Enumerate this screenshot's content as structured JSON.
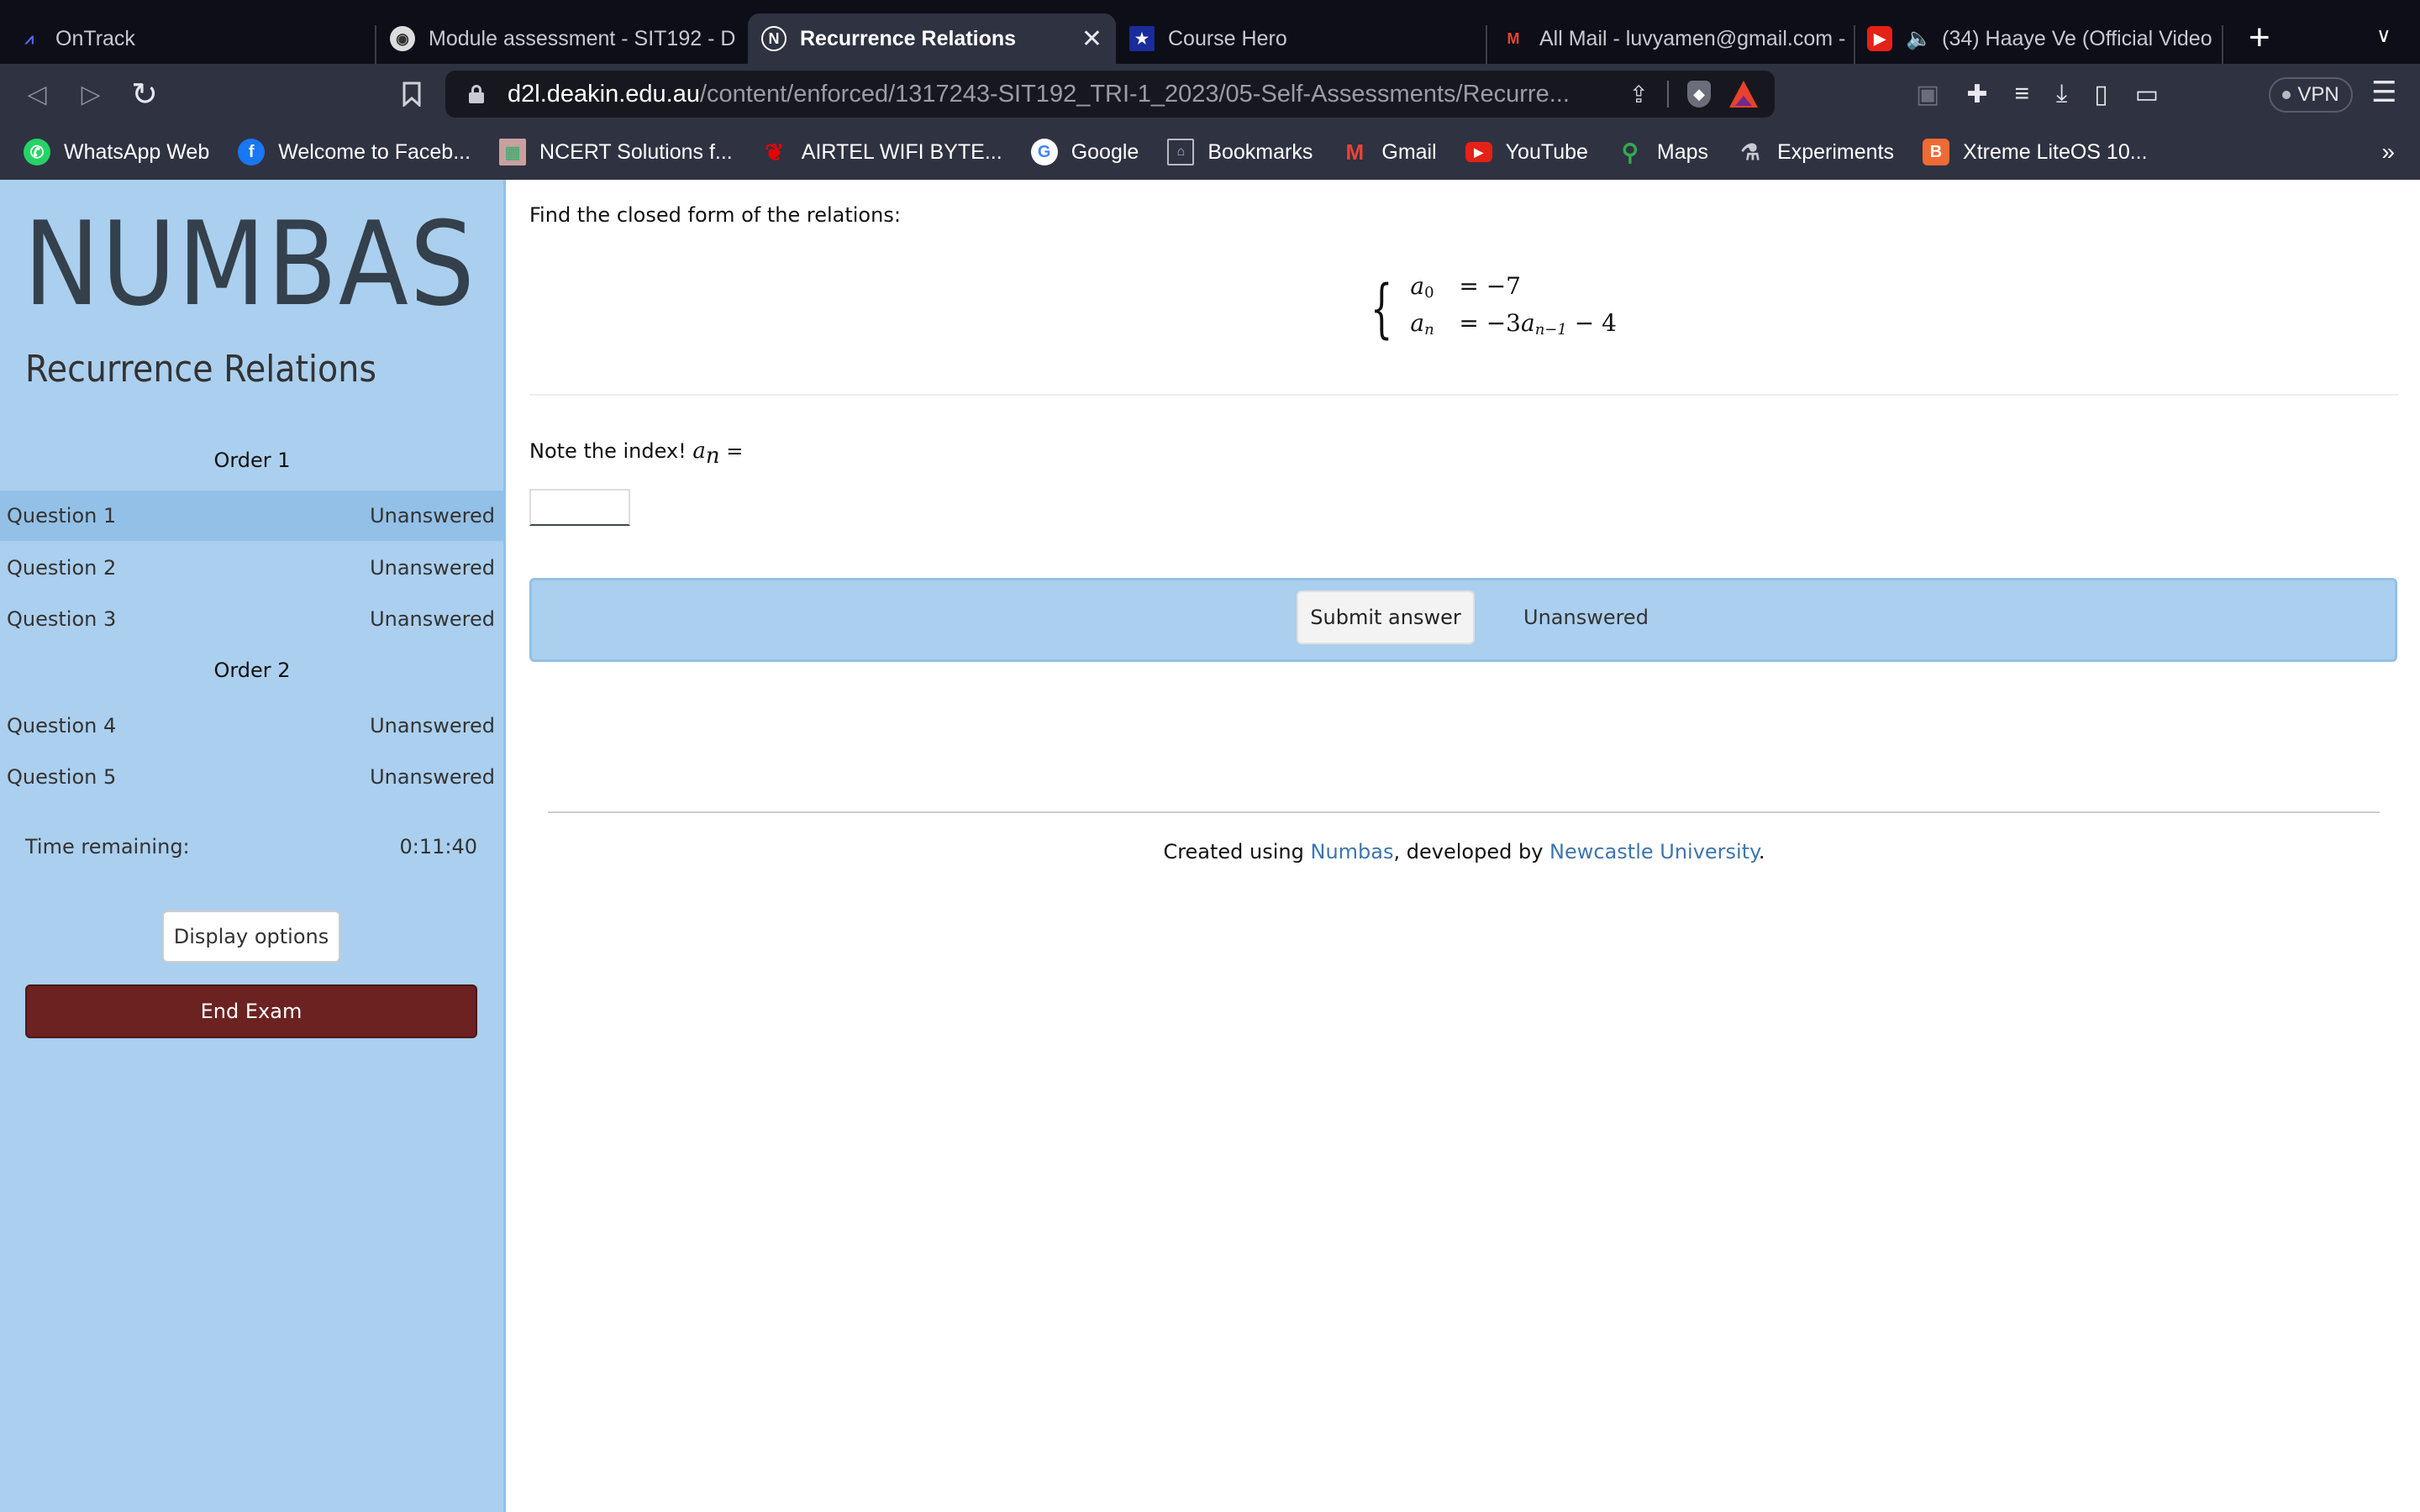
{
  "browser": {
    "tabs": [
      {
        "title": "OnTrack",
        "icon": "ontrack-logo-icon",
        "active": false
      },
      {
        "title": "Module assessment - SIT192 - D",
        "icon": "deakin-crest-icon",
        "active": false
      },
      {
        "title": "Recurrence Relations",
        "icon": "numbas-n-icon",
        "active": true
      },
      {
        "title": "Course Hero",
        "icon": "course-hero-star-icon",
        "active": false
      },
      {
        "title": "All Mail - luvyamen@gmail.com -",
        "icon": "gmail-icon",
        "active": false
      },
      {
        "title": "(34) Haaye Ve (Official Video",
        "icon": "youtube-icon",
        "active": false
      }
    ],
    "new_tab_label": "+",
    "url_host": "d2l.deakin.edu.au",
    "url_path": "/content/enforced/1317243-SIT192_TRI-1_2023/05-Self-Assessments/Recurre...",
    "vpn_label": "VPN",
    "bookmarks": [
      {
        "label": "WhatsApp Web",
        "icon": "whatsapp-icon",
        "color": "#25d366"
      },
      {
        "label": "Welcome to Faceb...",
        "icon": "facebook-icon",
        "color": "#1877f2"
      },
      {
        "label": "NCERT Solutions f...",
        "icon": "ncert-icon",
        "color": "#c9a0a0"
      },
      {
        "label": "AIRTEL WIFI BYTE...",
        "icon": "airtel-icon",
        "color": "#e40000"
      },
      {
        "label": "Google",
        "icon": "google-icon",
        "color": "#ffffff"
      },
      {
        "label": "Bookmarks",
        "icon": "bookmarks-book-icon",
        "color": "#2f3241"
      },
      {
        "label": "Gmail",
        "icon": "gmail-icon",
        "color": "#2f3241"
      },
      {
        "label": "YouTube",
        "icon": "youtube-icon",
        "color": "#e62117"
      },
      {
        "label": "Maps",
        "icon": "maps-pin-icon",
        "color": "#2f3241"
      },
      {
        "label": "Experiments",
        "icon": "flask-icon",
        "color": "#2f3241"
      },
      {
        "label": "Xtreme LiteOS 10...",
        "icon": "blogger-icon",
        "color": "#f06a35"
      }
    ],
    "bookmarks_overflow": "»"
  },
  "sidebar": {
    "logo": "NUMBAS",
    "exam_title": "Recurrence Relations",
    "groups": [
      {
        "title": "Order 1",
        "questions": [
          {
            "label": "Question 1",
            "status": "Unanswered",
            "current": true
          },
          {
            "label": "Question 2",
            "status": "Unanswered",
            "current": false
          },
          {
            "label": "Question 3",
            "status": "Unanswered",
            "current": false
          }
        ]
      },
      {
        "title": "Order 2",
        "questions": [
          {
            "label": "Question 4",
            "status": "Unanswered",
            "current": false
          },
          {
            "label": "Question 5",
            "status": "Unanswered",
            "current": false
          }
        ]
      }
    ],
    "time_label": "Time remaining:",
    "time_value": "0:11:40",
    "display_options_label": "Display options",
    "end_exam_label": "End Exam"
  },
  "question": {
    "prompt": "Find the closed form of the relations:",
    "relations": [
      {
        "lhs_var": "a",
        "lhs_sub": "0",
        "rhs": "= −7"
      },
      {
        "lhs_var": "a",
        "lhs_sub": "n",
        "rhs_prefix": "= −3",
        "rhs_var": "a",
        "rhs_sub": "n−1",
        "rhs_suffix": " − 4"
      }
    ],
    "note_text": "Note the index! ",
    "note_var": "a",
    "note_sub": "n",
    "note_eq": " =",
    "answer_value": "",
    "submit_label": "Submit answer",
    "status": "Unanswered"
  },
  "footer": {
    "prefix": "Created using ",
    "link1": "Numbas",
    "middle": ", developed by ",
    "link2": "Newcastle University",
    "suffix": "."
  },
  "colors": {
    "sidebar_bg": "#abcfee",
    "current_question_bg": "#93c0e6",
    "end_exam_bg": "#6b2220",
    "link": "#3d75b0"
  }
}
